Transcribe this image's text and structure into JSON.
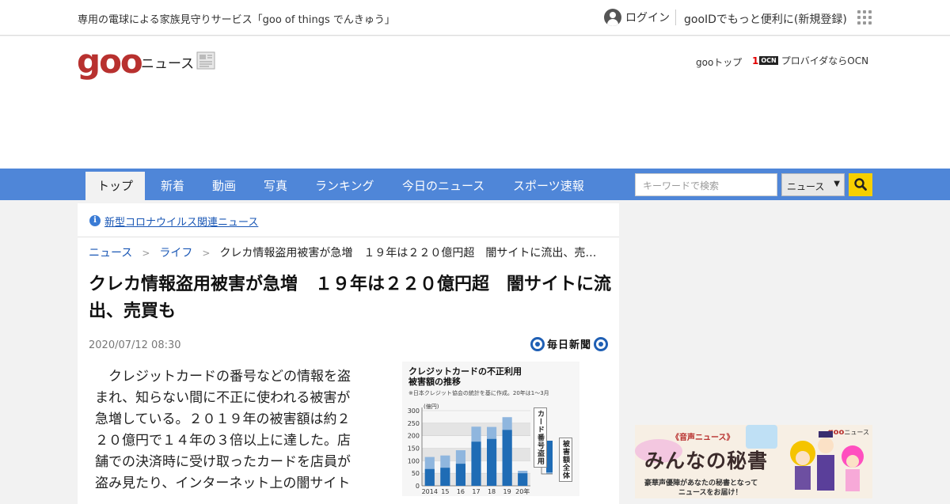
{
  "topbar": {
    "promo": "専用の電球による家族見守りサービス「goo of things でんきゅう」",
    "login": "ログイン",
    "register": "gooIDでもっと便利に(新規登録)"
  },
  "header": {
    "logo": "goo",
    "section": "ニュース",
    "goo_top": "gooトップ",
    "ocn_badge_red": "1",
    "ocn_badge": "OCN",
    "ocn_text": "プロバイダならOCN"
  },
  "nav": {
    "tabs": [
      "トップ",
      "新着",
      "動画",
      "写真",
      "ランキング",
      "今日のニュース",
      "スポーツ速報"
    ],
    "search_placeholder": "キーワードで検索",
    "search_scope": "ニュース"
  },
  "article": {
    "covid_link": "新型コロナウイルス関連ニュース",
    "breadcrumb": [
      "ニュース",
      "ライフ",
      "クレカ情報盗用被害が急増　１９年は２２０億円超　闇サイトに流出、売…"
    ],
    "title": "クレカ情報盗用被害が急増　１９年は２２０億円超　闇サイトに流出、売買も",
    "date": "2020/07/12 08:30",
    "source": "毎日新聞",
    "body": "クレジットカードの番号などの情報を盗まれ、知らない間に不正に使われる被害が急増している。２０１９年の被害額は約２２０億円で１４年の３倍以上に達した。店舗での決済時に受け取ったカードを店員が盗み見たり、インターネット上の闇サイト"
  },
  "chart_data": {
    "type": "bar",
    "title": "クレジットカードの不正利用被害額の推移",
    "title_line1": "クレジットカードの不正利用",
    "title_line2": "被害額の推移",
    "note": "※日本クレジット協会の統計を基に作成。20年は1～3月",
    "ylabel": "(億円)",
    "ylim": [
      0,
      300
    ],
    "yticks": [
      "300",
      "250",
      "200",
      "150",
      "100",
      "50",
      "0"
    ],
    "categories": [
      "2014",
      "15",
      "16",
      "17",
      "18",
      "19",
      "20年"
    ],
    "series": [
      {
        "name": "番号盗用",
        "values": [
          67,
          72,
          88,
          176,
          187,
          223,
          50
        ],
        "color": "#1f6cb5"
      },
      {
        "name": "被害額全体",
        "values": [
          115,
          121,
          142,
          236,
          235,
          274,
          60
        ],
        "color": "#8fb6de"
      }
    ],
    "legend_stolen": "カード番号盗用",
    "legend_total": "被害額全体",
    "grid": true
  },
  "ad": {
    "tag": "《音声ニュース》",
    "headline": "みんなの秘書",
    "line1": "豪華声優陣があなたの秘書となって",
    "line2": "ニュースをお届け！",
    "brand_logo": "goo",
    "brand_text": "ニュース"
  },
  "colors": {
    "nav": "#4f86d8",
    "logo": "#b8312f",
    "search_button": "#f7d000",
    "link": "#1a57b5"
  }
}
